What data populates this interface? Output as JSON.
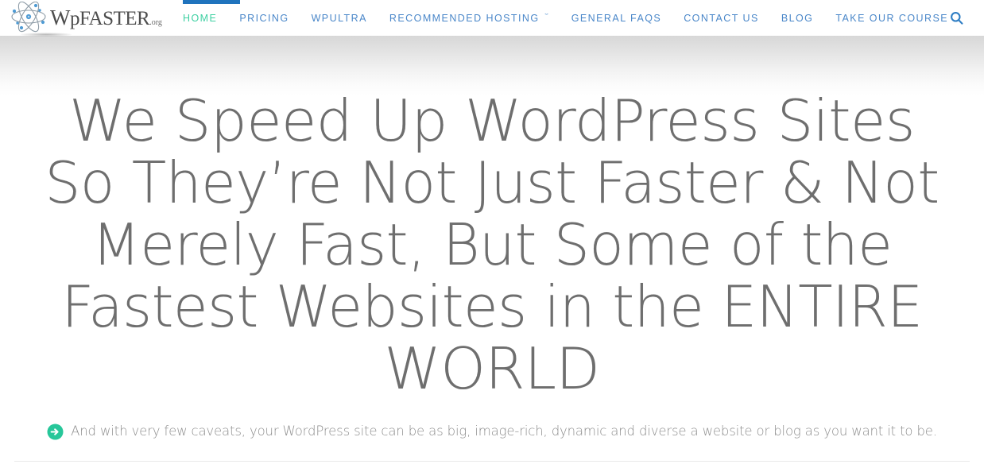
{
  "header": {
    "logo": {
      "icon": "atom-icon",
      "word_main": "W",
      "word_rest": "pFASTER",
      "word_suffix": ".org"
    },
    "nav": [
      {
        "label": "HOME",
        "active": true,
        "has_dropdown": false
      },
      {
        "label": "PRICING",
        "active": false,
        "has_dropdown": false
      },
      {
        "label": "WPULTRA",
        "active": false,
        "has_dropdown": false
      },
      {
        "label": "RECOMMENDED HOSTING",
        "active": false,
        "has_dropdown": true
      },
      {
        "label": "GENERAL FAQS",
        "active": false,
        "has_dropdown": false
      },
      {
        "label": "CONTACT US",
        "active": false,
        "has_dropdown": false
      },
      {
        "label": "BLOG",
        "active": false,
        "has_dropdown": false
      },
      {
        "label": "TAKE OUR COURSE",
        "active": false,
        "has_dropdown": false
      }
    ],
    "search_icon": "search-icon",
    "dropdown_caret": "ˇ",
    "colors": {
      "active_link": "#3ed0a2",
      "link": "#4a87c9",
      "active_bar": "#1f73bd",
      "search_icon": "#2f7ec4"
    }
  },
  "hero": {
    "title_lines": [
      "We Speed Up WordPress Sites",
      "So They’re Not Just Faster & Not",
      "Merely Fast, But Some of the",
      "Fastest Websites in the ENTIRE",
      "WORLD"
    ],
    "subtitle_icon": "arrow-circle-right-icon",
    "subtitle": "And with very few caveats, your WordPress site can be as big, image-rich, dynamic and diverse a website or blog as you want it to be.",
    "colors": {
      "title": "#6e6e6e",
      "subtitle": "#8e8e8e",
      "subtitle_icon": "#27c79a"
    }
  }
}
